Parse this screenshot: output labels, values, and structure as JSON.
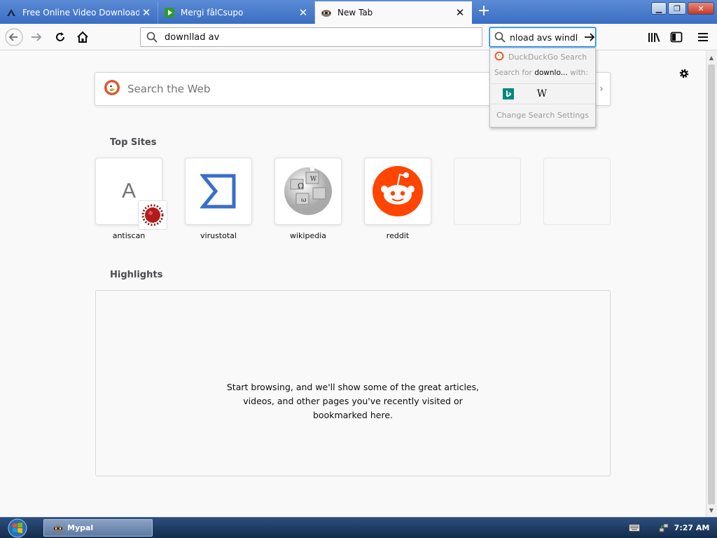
{
  "tabs": [
    {
      "title": "Free Online Video Downloader",
      "icon": "arrow-up-logo-icon",
      "active": false
    },
    {
      "title": "Mergi fâlCsupo",
      "icon": "green-play-icon",
      "active": false
    },
    {
      "title": "New Tab",
      "icon": "mypal-raccoon-icon",
      "active": true
    }
  ],
  "toolbar": {
    "url_value": "downllad av",
    "search_value": "nload avs windl"
  },
  "newtab": {
    "search_placeholder": "Search the Web",
    "topsites_title": "Top Sites",
    "topsites": [
      {
        "label": "antiscan",
        "icon": "letter-a-icon"
      },
      {
        "label": "virustotal",
        "icon": "sigma-icon"
      },
      {
        "label": "wikipedia",
        "icon": "wikipedia-globe-icon"
      },
      {
        "label": "reddit",
        "icon": "reddit-alien-icon"
      },
      {
        "label": "",
        "icon": ""
      },
      {
        "label": "",
        "icon": ""
      }
    ],
    "antiscan_letter": "A",
    "highlights_title": "Highlights",
    "highlights_message_line1": "Start browsing, and we'll show some of the great articles,",
    "highlights_message_line2": "videos, and other pages you've recently visited or",
    "highlights_message_line3": "bookmarked here."
  },
  "search_popup": {
    "engine_name": "DuckDuckGo Search",
    "search_for_prefix": "Search for",
    "search_for_term": "downlo...",
    "search_for_suffix": "with:",
    "settings_label": "Change Search Settings"
  },
  "taskbar": {
    "app_label": "Mypal",
    "clock": "7:27 AM"
  },
  "colors": {
    "tab_strip": "#3a6ec2",
    "accent": "#0a84ff",
    "reddit": "#ff4500",
    "virustotal": "#3a6fc8",
    "close_red": "#c33a24"
  }
}
